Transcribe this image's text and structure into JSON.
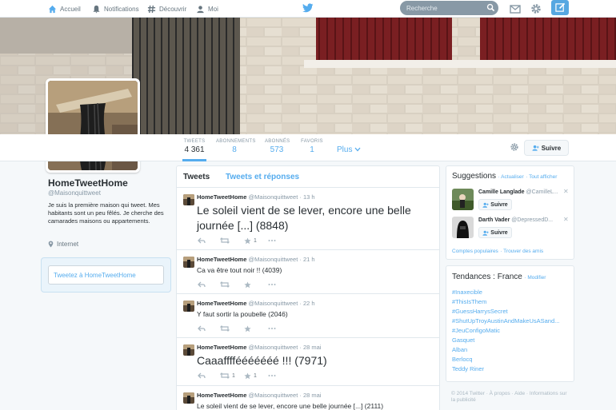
{
  "nav": {
    "home": "Accueil",
    "notifications": "Notifications",
    "discover": "Découvrir",
    "me": "Moi",
    "search_placeholder": "Recherche"
  },
  "profile": {
    "name": "HomeTweetHome",
    "handle": "@Maisonquittweet",
    "bio": "Je suis la première maison qui tweet. Mes habitants sont un peu fêlés. Je cherche des camarades maisons ou appartements.",
    "location": "Internet",
    "tweet_to": "Tweetez à HomeTweetHome"
  },
  "stats": [
    {
      "label": "TWEETS",
      "value": "4 361"
    },
    {
      "label": "ABONNEMENTS",
      "value": "8"
    },
    {
      "label": "ABONNÉS",
      "value": "573"
    },
    {
      "label": "FAVORIS",
      "value": "1"
    }
  ],
  "more_label": "Plus",
  "follow_label": "Suivre",
  "tabs": {
    "tweets": "Tweets",
    "replies": "Tweets et réponses"
  },
  "tweets": [
    {
      "name": "HomeTweetHome",
      "handle": "@Maisonquittweet",
      "time": "· 13 h",
      "text": "Le soleil vient de se lever, encore une belle journée [...] (8848)",
      "fav": "1",
      "rt": ""
    },
    {
      "name": "HomeTweetHome",
      "handle": "@Maisonquittweet",
      "time": "· 21 h",
      "text": "Ca va être tout noir !! (4039)",
      "fav": "",
      "rt": ""
    },
    {
      "name": "HomeTweetHome",
      "handle": "@Maisonquittweet",
      "time": "· 22 h",
      "text": "Y faut sortir la poubelle (2046)",
      "fav": "",
      "rt": ""
    },
    {
      "name": "HomeTweetHome",
      "handle": "@Maisonquittweet",
      "time": "· 28 mai",
      "text": "Caaaffffééééééé !!! (7971)",
      "fav": "1",
      "rt": "1"
    },
    {
      "name": "HomeTweetHome",
      "handle": "@Maisonquittweet",
      "time": "· 28 mai",
      "text": "Le soleil vient de se lever, encore une belle journée [...] (2111)",
      "fav": "",
      "rt": ""
    }
  ],
  "suggestions": {
    "title": "Suggestions",
    "refresh": "· Actualiser",
    "all": "· Tout afficher",
    "users": [
      {
        "name": "Camille Langlade",
        "handle": "@CamilleL..."
      },
      {
        "name": "Darth Vader",
        "handle": "@DepressedD..."
      }
    ],
    "popular": "Comptes populaires",
    "find_friends": "· Trouver des amis"
  },
  "trends": {
    "title": "Tendances : France",
    "change": "· Modifier",
    "items": [
      "#Inaxecible",
      "#ThisIsThem",
      "#GuessHarrysSecret",
      "#ShutUpTroyAustinAndMakeUsASand...",
      "#JeuConfigoMatic",
      "Gasquet",
      "Alban",
      "Berlocq",
      "Teddy Riner"
    ]
  },
  "footer": "© 2014 Twitter · À propos · Aide · Informations sur la publicité",
  "colors": {
    "accent": "#55acee",
    "nav_bg": "#ffffff",
    "page_bg": "#f5f8fa"
  }
}
